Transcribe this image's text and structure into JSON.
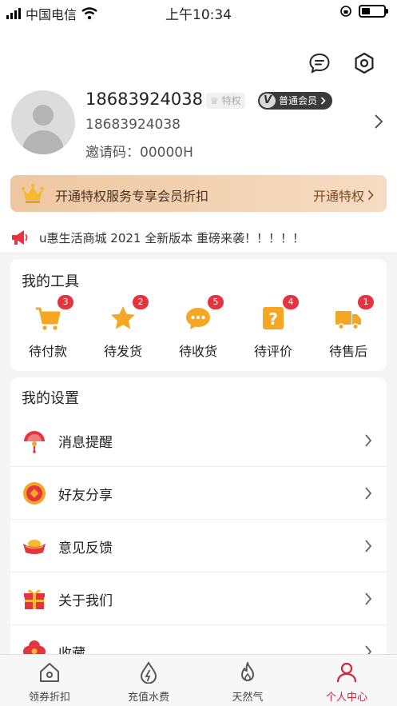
{
  "status_bar": {
    "carrier": "中国电信",
    "time": "上午10:34"
  },
  "profile": {
    "username": "18683924038",
    "privilege_tag": "特权",
    "member_level": "普通会员",
    "user_id": "18683924038",
    "invite_code": "邀请码：00000H"
  },
  "vip_banner": {
    "text": "开通特权服务专享会员折扣",
    "action": "开通特权"
  },
  "notice": {
    "text": "u惠生活商城  2021 全新版本 重磅来袭！！！！！"
  },
  "tools": {
    "title": "我的工具",
    "items": [
      {
        "label": "待付款",
        "badge": "3",
        "icon": "cart-icon"
      },
      {
        "label": "待发货",
        "badge": "2",
        "icon": "star-icon"
      },
      {
        "label": "待收货",
        "badge": "5",
        "icon": "chat-bubble-icon"
      },
      {
        "label": "待评价",
        "badge": "4",
        "icon": "question-icon"
      },
      {
        "label": "待售后",
        "badge": "1",
        "icon": "truck-icon"
      }
    ]
  },
  "settings": {
    "title": "我的设置",
    "items": [
      {
        "label": "消息提醒",
        "icon": "fan-icon"
      },
      {
        "label": "好友分享",
        "icon": "coin-icon"
      },
      {
        "label": "意见反馈",
        "icon": "ingot-icon"
      },
      {
        "label": "关于我们",
        "icon": "gift-icon"
      },
      {
        "label": "收藏",
        "icon": "flower-icon"
      }
    ]
  },
  "tabbar": {
    "tabs": [
      {
        "label": "领券折扣",
        "icon": "home-icon",
        "active": false
      },
      {
        "label": "充值水费",
        "icon": "water-drop-icon",
        "active": false
      },
      {
        "label": "天然气",
        "icon": "flame-icon",
        "active": false
      },
      {
        "label": "个人中心",
        "icon": "person-icon",
        "active": true
      }
    ]
  },
  "colors": {
    "accent": "#d4243a",
    "badge": "#e5343f",
    "icon_orange": "#f5a623",
    "vip_gradient_start": "#eec7a1"
  }
}
